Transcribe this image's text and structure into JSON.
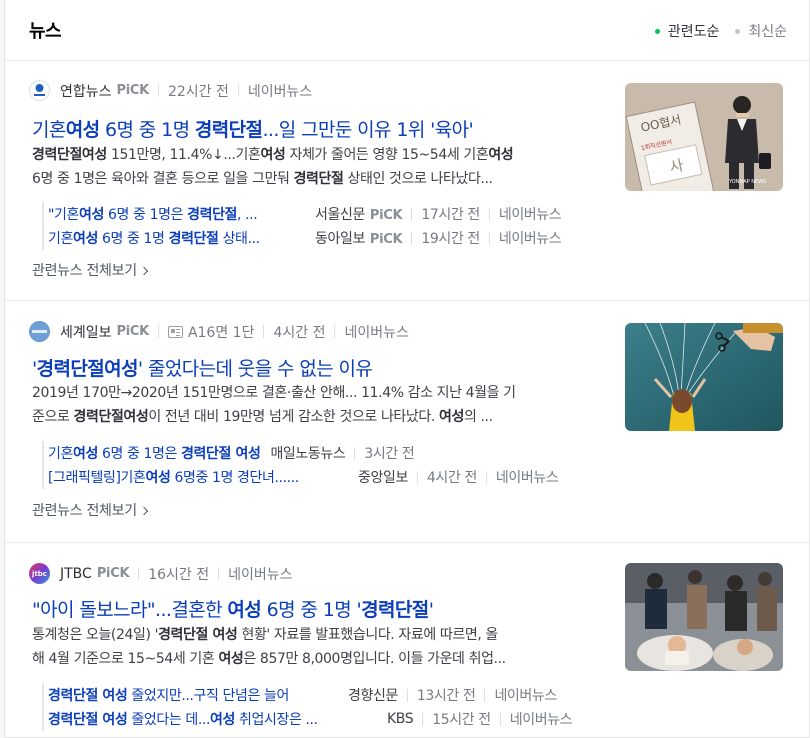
{
  "header": {
    "title": "뉴스",
    "sort_relevance": "관련도순",
    "sort_latest": "최신순"
  },
  "articles": [
    {
      "source": "연합뉴스",
      "pick": "PiCK",
      "time": "22시간 전",
      "portal": "네이버뉴스",
      "title_parts": [
        "기혼",
        "여성",
        " 6명 중 1명 ",
        "경력단절",
        "...일 그만둔 이유 1위 '육아'"
      ],
      "desc_line1": [
        "경력단절여성",
        " 151만명, 11.4%↓...기혼",
        "여성",
        " 자체가 줄어든 영향 15~54세 기혼",
        "여성"
      ],
      "desc_line2": [
        "6명 중 1명은 육아와 결혼 등으로 일을 그만둬 ",
        "경력단절",
        " 상태인 것으로 나타났다..."
      ],
      "related": [
        {
          "title_parts": [
            "\"기혼",
            "여성",
            " 6명 중 1명은 ",
            "경력단절",
            ", ..."
          ],
          "source": "서울신문",
          "pick": "PiCK",
          "time": "17시간 전",
          "portal": "네이버뉴스"
        },
        {
          "title_parts": [
            "기혼",
            "여성",
            " 6명 중 1명 ",
            "경력단절",
            " 상태..."
          ],
          "source": "동아일보",
          "pick": "PiCK",
          "time": "19시간 전",
          "portal": "네이버뉴스"
        }
      ],
      "more": "관련뉴스 전체보기",
      "image_text": "YONHAP NEWS"
    },
    {
      "source": "세계일보",
      "pick": "PiCK",
      "paper_info": "A16면 1단",
      "time": "4시간 전",
      "portal": "네이버뉴스",
      "title_parts": [
        "'",
        "경력단절여성",
        "' 줄었다는데 웃을 수 없는 이유"
      ],
      "desc_line1": [
        "2019년 170만→2020년 151만명으로 결혼·출산 안해... 11.4% 감소 지난 4월을 기"
      ],
      "desc_line2": [
        "준으로 ",
        "경력단절여성",
        "이 전년 대비 19만명 넘게 감소한 것으로 나타났다. ",
        "여성",
        "의 ..."
      ],
      "related": [
        {
          "title_parts": [
            "기혼",
            "여성",
            " 6명 중 1명은 ",
            "경력단절 여성"
          ],
          "source": "매일노동뉴스",
          "time": "3시간 전"
        },
        {
          "title_parts": [
            "[그래픽텔링]기혼",
            "여성",
            " 6명중 1명 경단녀......"
          ],
          "source": "중앙일보",
          "time": "4시간 전",
          "portal": "네이버뉴스"
        }
      ],
      "more": "관련뉴스 전체보기"
    },
    {
      "source": "JTBC",
      "pick": "PiCK",
      "time": "16시간 전",
      "portal": "네이버뉴스",
      "title_parts": [
        "\"아이 돌보느라\"...결혼한 ",
        "여성",
        " 6명 중 1명 '",
        "경력단절",
        "'"
      ],
      "desc_line1": [
        "통계청은 오늘(24일) '",
        "경력단절 여성",
        " 현황' 자료를 발표했습니다. 자료에 따르면, 올"
      ],
      "desc_line2": [
        "해 4월 기준으로 15~54세 기혼 ",
        "여성",
        "은 857만 8,000명입니다. 이들 가운데 취업..."
      ],
      "related": [
        {
          "title_parts": [
            "경력단절 여성",
            " 줄었지만...구직 단념은 늘어"
          ],
          "source": "경향신문",
          "time": "13시간 전",
          "portal": "네이버뉴스"
        },
        {
          "title_parts": [
            "경력단절 여성",
            " 줄었다는 데...",
            "여성",
            " 취업시장은 ..."
          ],
          "source": "KBS",
          "time": "15시간 전",
          "portal": "네이버뉴스"
        }
      ]
    }
  ],
  "colors": {
    "link": "#0b3eb8",
    "accent_green": "#03c75a",
    "muted": "#767b83"
  }
}
